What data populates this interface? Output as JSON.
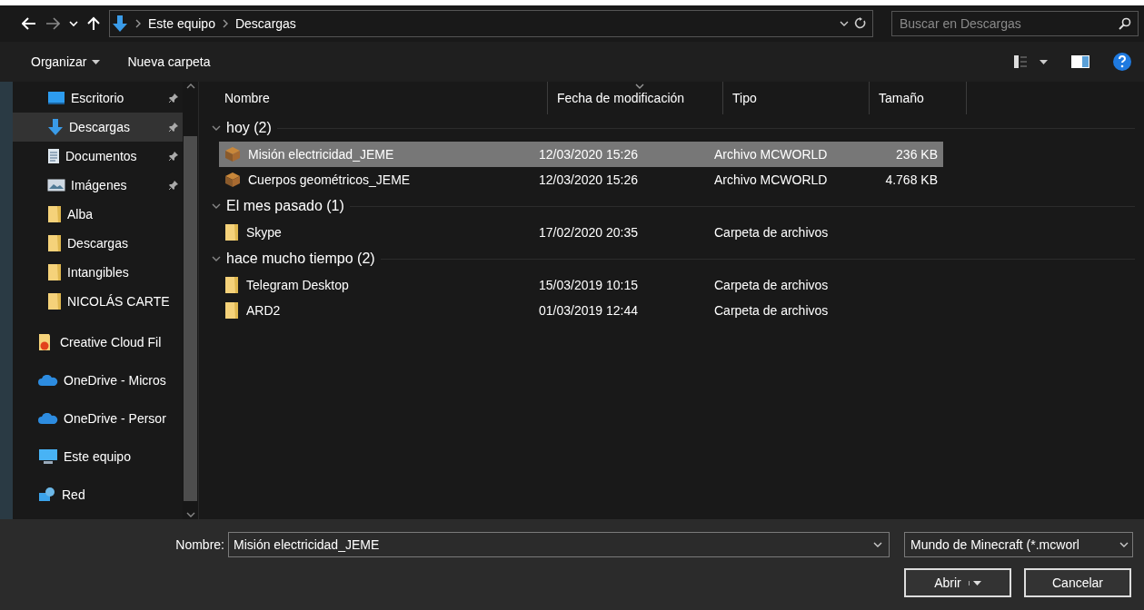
{
  "nav": {
    "breadcrumb": [
      "Este equipo",
      "Descargas"
    ],
    "search_placeholder": "Buscar en Descargas"
  },
  "toolbar": {
    "organize": "Organizar",
    "new_folder": "Nueva carpeta"
  },
  "sidebar": {
    "quick_access": [
      {
        "label": "Escritorio",
        "kind": "desktop",
        "pinned": true,
        "selected": false
      },
      {
        "label": "Descargas",
        "kind": "download",
        "pinned": true,
        "selected": true
      },
      {
        "label": "Documentos",
        "kind": "document",
        "pinned": true,
        "selected": false
      },
      {
        "label": "Imágenes",
        "kind": "image",
        "pinned": true,
        "selected": false
      },
      {
        "label": "Alba",
        "kind": "folder",
        "pinned": false,
        "selected": false
      },
      {
        "label": "Descargas",
        "kind": "folder",
        "pinned": false,
        "selected": false
      },
      {
        "label": "Intangibles",
        "kind": "folder",
        "pinned": false,
        "selected": false
      },
      {
        "label": "NICOLÁS CARTE",
        "kind": "folder",
        "pinned": false,
        "selected": false
      }
    ],
    "locations": [
      {
        "label": "Creative Cloud Fil",
        "kind": "cc",
        "selected": false
      },
      {
        "label": "OneDrive - Micros",
        "kind": "cloud",
        "selected": false
      },
      {
        "label": "OneDrive - Persor",
        "kind": "cloud",
        "selected": false
      },
      {
        "label": "Este equipo",
        "kind": "computer",
        "selected": false
      },
      {
        "label": "Red",
        "kind": "network",
        "selected": false
      }
    ]
  },
  "columns": [
    {
      "label": "Nombre",
      "sorted": false
    },
    {
      "label": "Fecha de modificación",
      "sorted": true
    },
    {
      "label": "Tipo",
      "sorted": false
    },
    {
      "label": "Tamaño",
      "sorted": false
    }
  ],
  "groups": [
    {
      "title": "hoy (2)",
      "expanded": true,
      "items": [
        {
          "name": "Misión electricidad_JEME",
          "date": "12/03/2020 15:26",
          "type": "Archivo MCWORLD",
          "size": "236 KB",
          "kind": "block",
          "selected": true
        },
        {
          "name": "Cuerpos geométricos_JEME",
          "date": "12/03/2020 15:26",
          "type": "Archivo MCWORLD",
          "size": "4.768 KB",
          "kind": "block",
          "selected": false
        }
      ]
    },
    {
      "title": "El mes pasado (1)",
      "expanded": true,
      "items": [
        {
          "name": "Skype",
          "date": "17/02/2020 20:35",
          "type": "Carpeta de archivos",
          "kind": "folder",
          "selected": false
        }
      ]
    },
    {
      "title": "hace mucho tiempo (2)",
      "expanded": true,
      "items": [
        {
          "name": "Telegram Desktop",
          "date": "15/03/2019 10:15",
          "type": "Carpeta de archivos",
          "kind": "folder",
          "selected": false
        },
        {
          "name": "ARD2",
          "date": "01/03/2019 12:44",
          "type": "Carpeta de archivos",
          "kind": "folder",
          "selected": false
        }
      ]
    }
  ],
  "footer": {
    "name_label": "Nombre:",
    "name_value": "Misión electricidad_JEME",
    "filter": "Mundo de Minecraft (*.mcworl",
    "open": "Abrir",
    "cancel": "Cancelar"
  }
}
